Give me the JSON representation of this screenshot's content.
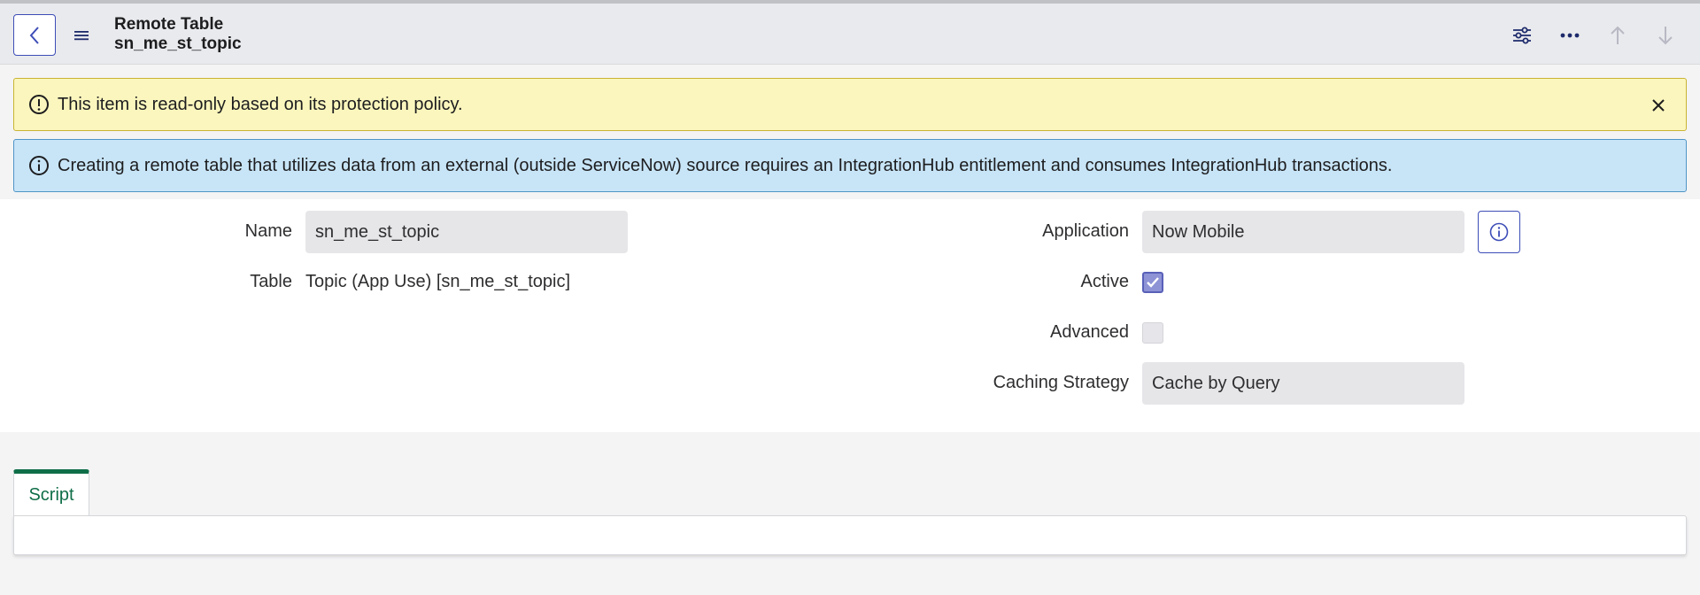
{
  "header": {
    "record_type": "Remote Table",
    "record_name": "sn_me_st_topic"
  },
  "icons": {
    "back": "chevron-left-icon",
    "menu": "hamburger-menu-icon",
    "personalize": "sliders-icon",
    "more": "more-options-icon",
    "prev": "arrow-up-icon",
    "next": "arrow-down-icon",
    "warning": "exclamation-circle-icon",
    "info": "info-circle-icon",
    "close": "close-icon"
  },
  "alerts": {
    "warning": "This item is read-only based on its protection policy.",
    "info": "Creating a remote table that utilizes data from an external (outside ServiceNow) source requires an IntegrationHub entitlement and consumes IntegrationHub transactions."
  },
  "form": {
    "name_label": "Name",
    "name_value": "sn_me_st_topic",
    "table_label": "Table",
    "table_value": "Topic (App Use) [sn_me_st_topic]",
    "application_label": "Application",
    "application_value": "Now Mobile",
    "active_label": "Active",
    "active_checked": true,
    "advanced_label": "Advanced",
    "advanced_checked": false,
    "caching_label": "Caching Strategy",
    "caching_value": "Cache by Query"
  },
  "tabs": [
    {
      "label": "Script",
      "active": true
    }
  ],
  "colors": {
    "accent": "#3d4db7",
    "tab_active": "#0f6e48",
    "warning_bg": "#fbf6bd",
    "info_bg": "#c8e5f7"
  }
}
